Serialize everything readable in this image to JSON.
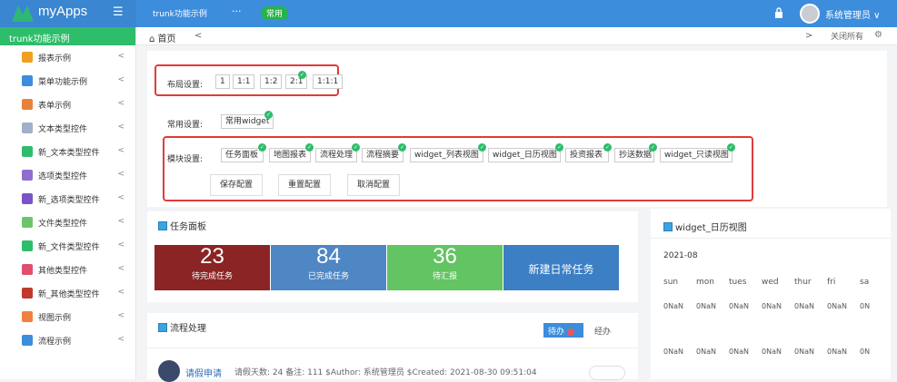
{
  "app": {
    "name": "myApps"
  },
  "topbar": {
    "nav_title": "trunk功能示例",
    "more": "···",
    "chip": "常用",
    "user": "系统管理员 ∨"
  },
  "sidebar": {
    "header": "trunk功能示例",
    "items": [
      {
        "label": "报表示例",
        "color": "#f0a020"
      },
      {
        "label": "菜单功能示例",
        "color": "#3c8ddc"
      },
      {
        "label": "表单示例",
        "color": "#e8823a"
      },
      {
        "label": "文本类型控件",
        "color": "#9fb0c8"
      },
      {
        "label": "新_文本类型控件",
        "color": "#2ebd6a"
      },
      {
        "label": "选项类型控件",
        "color": "#8e6dd1"
      },
      {
        "label": "新_选项类型控件",
        "color": "#7b52c9"
      },
      {
        "label": "文件类型控件",
        "color": "#6cc56c"
      },
      {
        "label": "新_文件类型控件",
        "color": "#2ebd6a"
      },
      {
        "label": "其他类型控件",
        "color": "#e04f6b"
      },
      {
        "label": "新_其他类型控件",
        "color": "#c0392b"
      },
      {
        "label": "视图示例",
        "color": "#f08040"
      },
      {
        "label": "流程示例",
        "color": "#3c8ddc"
      }
    ]
  },
  "tabs": {
    "home": "首页",
    "close_all": "关闭所有"
  },
  "layout_settings": {
    "label": "布局设置:",
    "options": [
      "1",
      "1:1",
      "1:2",
      "2:1",
      "1:1:1"
    ]
  },
  "common_settings": {
    "label": "常用设置:",
    "options": [
      "常用widget"
    ]
  },
  "module_settings": {
    "label": "模块设置:",
    "options": [
      "任务面板",
      "地图报表",
      "流程处理",
      "流程摘要",
      "widget_列表视图",
      "widget_日历视图",
      "投资报表",
      "抄送数据",
      "widget_只读视图"
    ],
    "actions": [
      "保存配置",
      "重置配置",
      "取消配置"
    ]
  },
  "task_panel": {
    "title": "任务面板",
    "tiles": [
      {
        "num": "23",
        "label": "待完成任务",
        "color": "#8b2424"
      },
      {
        "num": "84",
        "label": "已完成任务",
        "color": "#4f86c4"
      },
      {
        "num": "36",
        "label": "待汇报",
        "color": "#62c462"
      },
      {
        "num": "",
        "label": "新建日常任务",
        "color": "#3c7fc5"
      }
    ]
  },
  "flow": {
    "title": "流程处理",
    "tab_pending": "待办",
    "tab_done": "经办",
    "entry_title": "请假申请",
    "entry_detail": "请假天数: 24 备注: 111 $Author: 系统管理员 $Created: 2021-08-30 09:51:04"
  },
  "calendar": {
    "title": "widget_日历视图",
    "month": "2021-08",
    "days": [
      "sun",
      "mon",
      "tues",
      "wed",
      "thur",
      "fri",
      "sa"
    ],
    "rows": [
      [
        "0NaN",
        "0NaN",
        "0NaN",
        "0NaN",
        "0NaN",
        "0NaN",
        "0N"
      ],
      [
        "0NaN",
        "0NaN",
        "0NaN",
        "0NaN",
        "0NaN",
        "0NaN",
        "0N"
      ]
    ]
  }
}
